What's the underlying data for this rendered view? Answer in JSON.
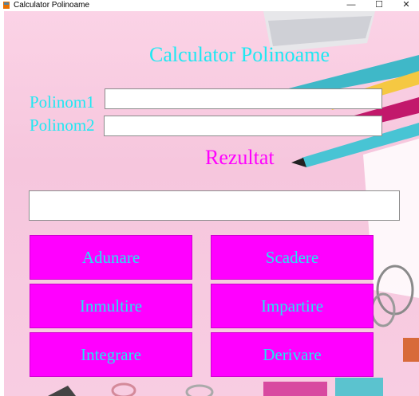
{
  "window": {
    "title": "Calculator Polinoame"
  },
  "heading": "Calculator Polinoame",
  "inputs": {
    "polinom1": {
      "label": "Polinom1",
      "value": ""
    },
    "polinom2": {
      "label": "Polinom2",
      "value": ""
    }
  },
  "result": {
    "label": "Rezultat",
    "value": ""
  },
  "buttons": {
    "adunare": "Adunare",
    "scadere": "Scadere",
    "inmultire": "Inmultire",
    "impartire": "Impartire",
    "integrare": "Integrare",
    "derivare": "Derivare"
  },
  "colors": {
    "accent_text": "#1fe8f2",
    "result_label": "#ff00ff",
    "button_bg": "#ff00ff",
    "background": "#f8cde2"
  }
}
